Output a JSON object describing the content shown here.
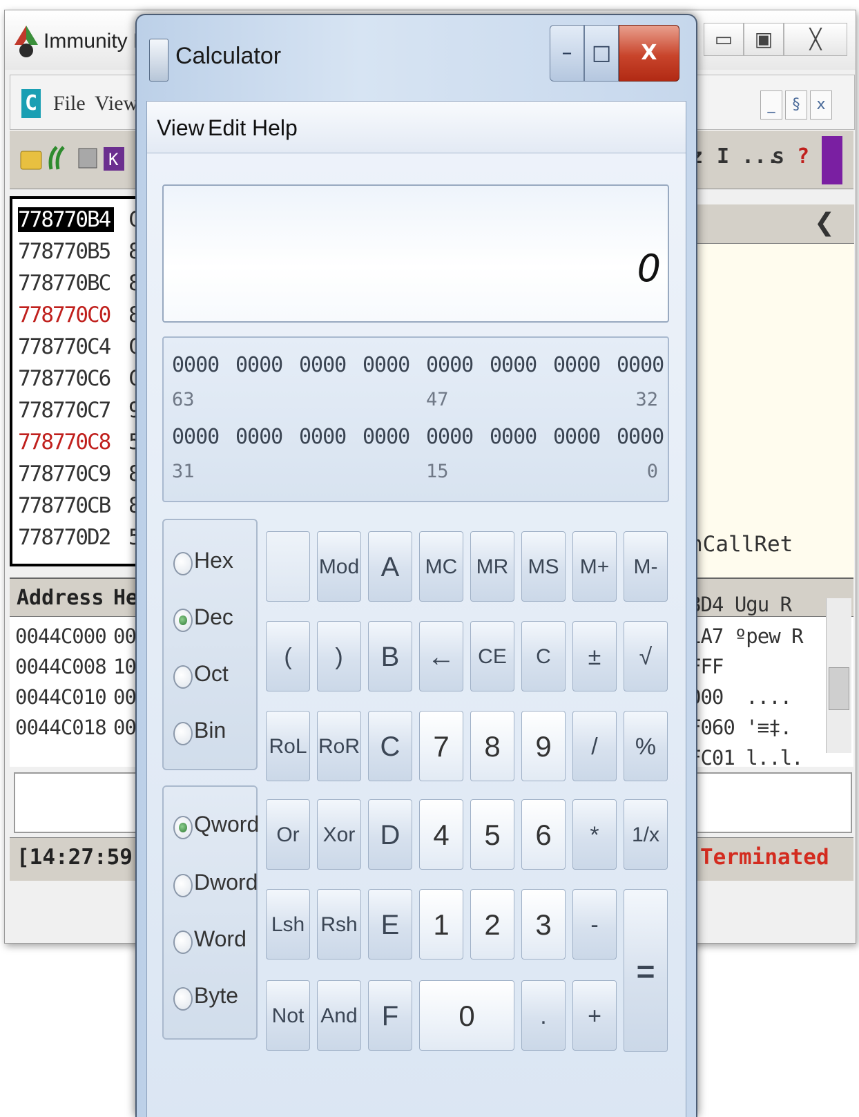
{
  "debugger": {
    "title": "Immunity De",
    "menu": [
      "File",
      "View"
    ],
    "mdi_buttons": [
      "_",
      "§",
      "x"
    ],
    "toolbar_letters": [
      "z",
      "I",
      "...",
      "s",
      "?"
    ],
    "window_buttons": [
      "▭",
      "▣",
      "╳"
    ],
    "cpu_rows": [
      {
        "addr": "778770B4",
        "byte": "C",
        "style": "sel"
      },
      {
        "addr": "778770B5",
        "byte": "8",
        "style": ""
      },
      {
        "addr": "778770BC",
        "byte": "8",
        "style": ""
      },
      {
        "addr": "778770C0",
        "byte": "8",
        "style": "red"
      },
      {
        "addr": "778770C4",
        "byte": "C",
        "style": ""
      },
      {
        "addr": "778770C6",
        "byte": "C",
        "style": ""
      },
      {
        "addr": "778770C7",
        "byte": "9",
        "style": ""
      },
      {
        "addr": "778770C8",
        "byte": "5",
        "style": "red"
      },
      {
        "addr": "778770C9",
        "byte": "8",
        "style": ""
      },
      {
        "addr": "778770CB",
        "byte": "8",
        "style": ""
      },
      {
        "addr": "778770D2",
        "byte": "5",
        "style": ""
      }
    ],
    "reg_callret": "nCallRet",
    "dump_headers": {
      "address": "Address",
      "hex": "He"
    },
    "dump_rows": [
      {
        "addr": "0044C000",
        "bytes": "00"
      },
      {
        "addr": "0044C008",
        "bytes": "10"
      },
      {
        "addr": "0044C010",
        "bytes": "00"
      },
      {
        "addr": "0044C018",
        "bytes": "00"
      }
    ],
    "stack_rows": [
      "8D4 Ugu R",
      "1A7 ºpew R",
      "FFF",
      "000  ....",
      "F060 '≡‡.",
      "FC01 l..l."
    ],
    "status_time": "[14:27:59]",
    "status_state": "Terminated"
  },
  "calculator": {
    "title": "Calculator",
    "window_buttons": {
      "minimize": "–",
      "maximize": "□",
      "close": "X"
    },
    "menu": [
      "View",
      "Edit",
      "Help"
    ],
    "display": "0",
    "bits": {
      "row1": [
        "0000",
        "0000",
        "0000",
        "0000",
        "0000",
        "0000",
        "0000",
        "0000"
      ],
      "row1_positions": [
        "63",
        "47",
        "32"
      ],
      "row2": [
        "0000",
        "0000",
        "0000",
        "0000",
        "0000",
        "0000",
        "0000",
        "0000"
      ],
      "row2_positions": [
        "31",
        "15",
        "0"
      ]
    },
    "base_options": [
      {
        "label": "Hex",
        "selected": false
      },
      {
        "label": "Dec",
        "selected": true
      },
      {
        "label": "Oct",
        "selected": false
      },
      {
        "label": "Bin",
        "selected": false
      }
    ],
    "word_options": [
      {
        "label": "Qword",
        "selected": true
      },
      {
        "label": "Dword",
        "selected": false
      },
      {
        "label": "Word",
        "selected": false
      },
      {
        "label": "Byte",
        "selected": false
      }
    ],
    "keys": {
      "row1": [
        "",
        "Mod",
        "A",
        "MC",
        "MR",
        "MS",
        "M+",
        "M-"
      ],
      "row2": [
        "(",
        ")",
        "B",
        "←",
        "CE",
        "C",
        "±",
        "√"
      ],
      "row3": [
        "RoL",
        "RoR",
        "C",
        "7",
        "8",
        "9",
        "/",
        "%"
      ],
      "row4": [
        "Or",
        "Xor",
        "D",
        "4",
        "5",
        "6",
        "*",
        "1/x"
      ],
      "row5": [
        "Lsh",
        "Rsh",
        "E",
        "1",
        "2",
        "3",
        "-",
        "="
      ],
      "row6": [
        "Not",
        "And",
        "F",
        "0",
        ".",
        "+"
      ]
    }
  }
}
